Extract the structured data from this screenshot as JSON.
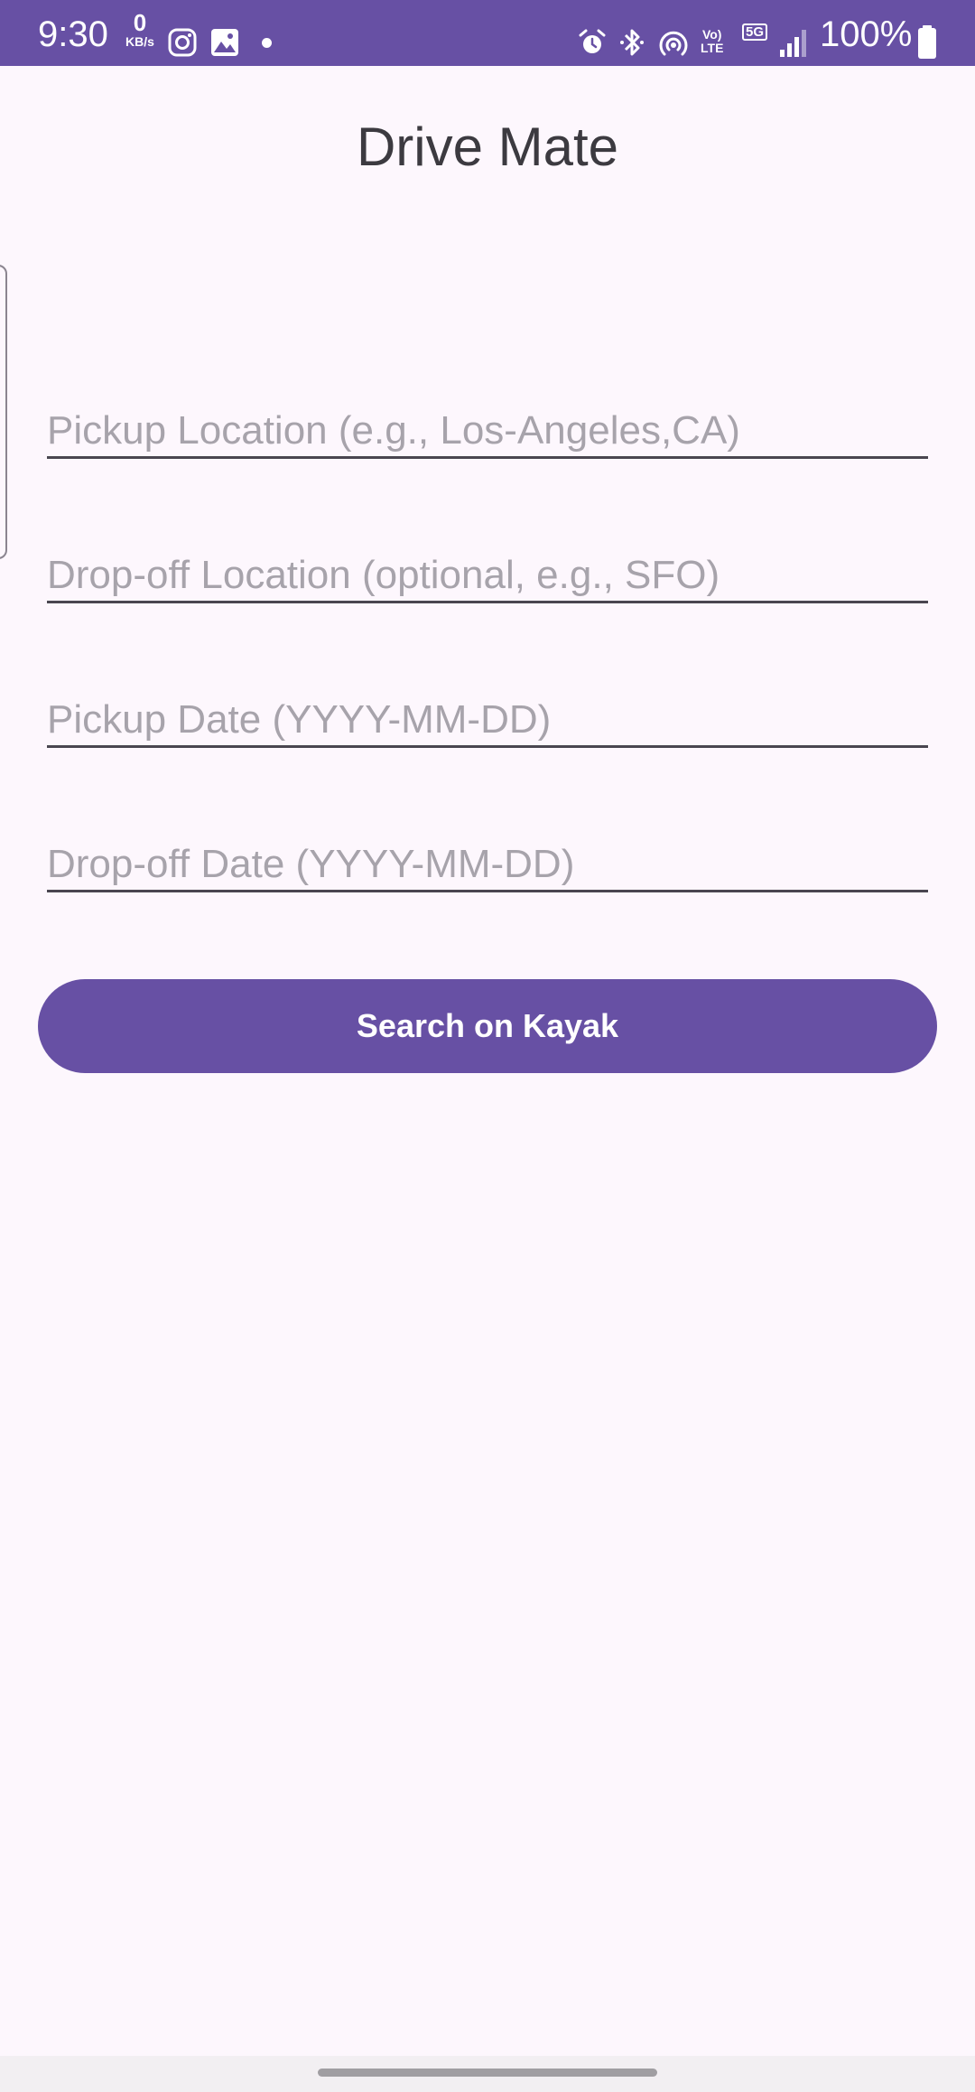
{
  "status_bar": {
    "time": "9:30",
    "data_speed_value": "0",
    "data_speed_unit": "KB/s",
    "volte_line1": "Vo)",
    "volte_line2": "LTE",
    "network_type": "5G",
    "battery_percent": "100%",
    "icons": [
      "instagram-icon",
      "gallery-icon",
      "notification-dot",
      "alarm-icon",
      "bluetooth-icon",
      "hotspot-icon",
      "volte-icon",
      "5g-icon",
      "signal-icon",
      "battery-icon"
    ]
  },
  "app": {
    "title": "Drive Mate"
  },
  "form": {
    "pickup_location_placeholder": "Pickup Location (e.g., Los-Angeles,CA)",
    "dropoff_location_placeholder": "Drop-off Location (optional, e.g., SFO)",
    "pickup_date_placeholder": "Pickup Date (YYYY-MM-DD)",
    "dropoff_date_placeholder": "Drop-off Date (YYYY-MM-DD)",
    "search_button_label": "Search on Kayak"
  },
  "colors": {
    "primary": "#6750a4",
    "background": "#fdf7fd",
    "placeholder": "#a7a3ab",
    "underline": "#4a4650"
  }
}
